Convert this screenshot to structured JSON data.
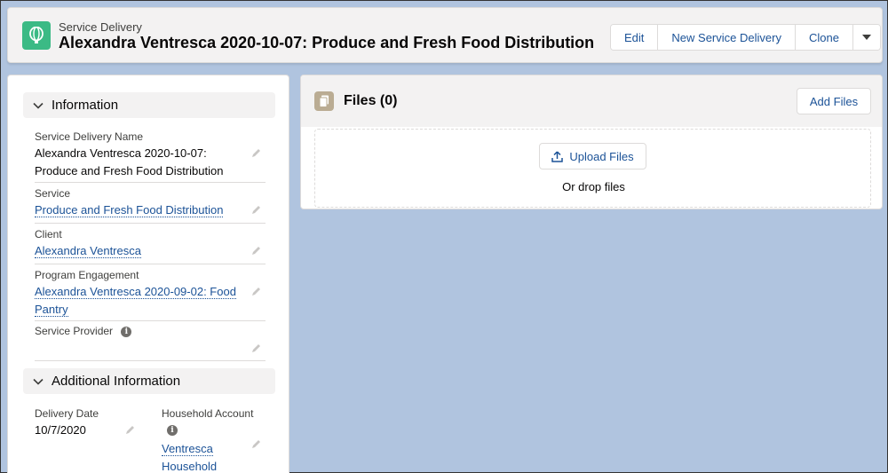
{
  "header": {
    "icon": "balloon-icon",
    "object_label": "Service Delivery",
    "title": "Alexandra Ventresca 2020-10-07: Produce and Fresh Food Distribution",
    "buttons": {
      "edit": "Edit",
      "new_service_delivery": "New Service Delivery",
      "clone": "Clone",
      "more": "chevron-down-icon"
    }
  },
  "information": {
    "heading": "Information",
    "fields": {
      "service_delivery_name": {
        "label": "Service Delivery Name",
        "value_line1": "Alexandra Ventresca 2020-10-07:",
        "value_line2": "Produce and Fresh Food Distribution"
      },
      "service": {
        "label": "Service",
        "value": "Produce and Fresh Food Distribution"
      },
      "client": {
        "label": "Client",
        "value": "Alexandra Ventresca"
      },
      "program_engagement": {
        "label": "Program Engagement",
        "value_line1": "Alexandra Ventresca 2020-09-02: Food",
        "value_line2": "Pantry"
      },
      "service_provider": {
        "label": "Service Provider",
        "value": ""
      }
    }
  },
  "additional_information": {
    "heading": "Additional Information",
    "fields": {
      "delivery_date": {
        "label": "Delivery Date",
        "value": "10/7/2020"
      },
      "household_account": {
        "label": "Household Account",
        "value_line1": "Ventresca",
        "value_line2": "Household"
      }
    }
  },
  "files": {
    "title": "Files (0)",
    "add_files": "Add Files",
    "upload_files": "Upload Files",
    "drop_text": "Or drop files"
  },
  "colors": {
    "accent": "#1b5297",
    "service_icon_bg": "#3bba85",
    "files_icon_bg": "#baac93",
    "background": "#b0c4df"
  }
}
